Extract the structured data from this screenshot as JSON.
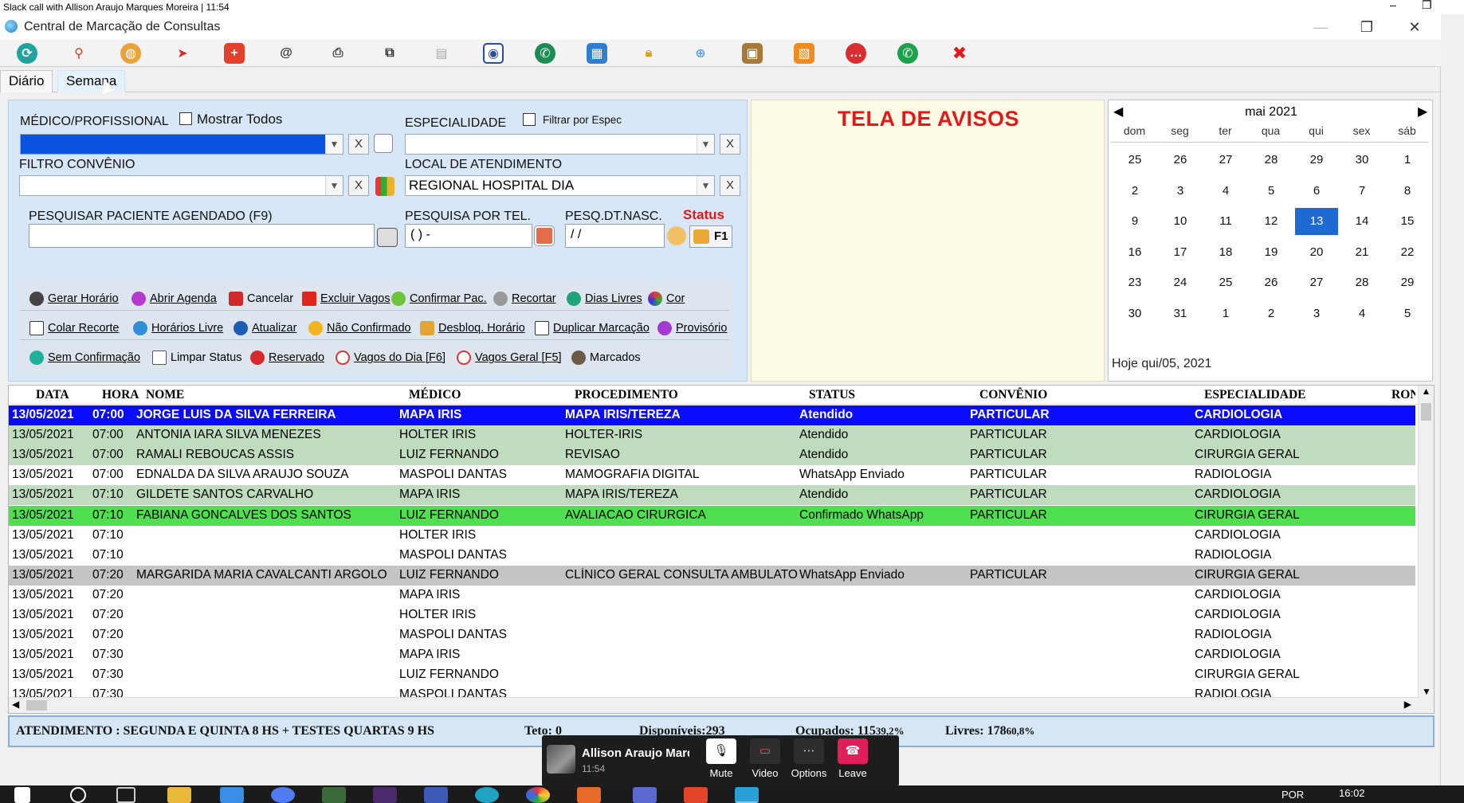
{
  "slack_bar": {
    "title": "Slack call with Allison Araujo Marques Moreira | 11:54"
  },
  "window": {
    "title": "Central de Marcação de Consultas"
  },
  "toolbar": {
    "icons": [
      "refresh-icon",
      "search-icon",
      "globe-icon",
      "fish-icon",
      "medical-kit-icon",
      "at-sign-icon",
      "print-icon",
      "copy-icon",
      "document-icon",
      "map-pin-icon",
      "whatsapp-green-icon",
      "calendar-icon",
      "lock-icon",
      "add-document-icon",
      "package-icon",
      "photo-icon",
      "chat-red-icon",
      "whatsapp-icon",
      "exit-icon"
    ]
  },
  "tabs": [
    {
      "label": "Diário"
    },
    {
      "label": "Semana"
    }
  ],
  "filters": {
    "medico_label": "MÉDICO/PROFISSIONAL",
    "mostrar_todos": "Mostrar Todos",
    "especialidade_label": "ESPECIALIDADE",
    "filtrar_espec": "Filtrar por Espec",
    "convenio_label": "FILTRO CONVÊNIO",
    "local_label": "LOCAL DE ATENDIMENTO",
    "local_value": "REGIONAL HOSPITAL DIA",
    "pesquisar_label": "PESQUISAR PACIENTE AGENDADO (F9)",
    "tel_label": "PESQUISA POR TEL.",
    "tel_value": "(  )     -",
    "nasc_label": "PESQ.DT.NASC.",
    "nasc_value": " /  /",
    "status_label": "Status",
    "f1_label": "F1",
    "x_label": "X"
  },
  "actions": {
    "gerar_horario": "Gerar Horário",
    "abrir_agenda": "Abrir Agenda",
    "cancelar": "Cancelar",
    "excluir_vagos": "Excluir Vagos",
    "confirmar_pac": "Confirmar Pac.",
    "recortar": "Recortar",
    "dias_livres": "Dias Livres",
    "cor": "Cor",
    "colar_recorte": "Colar Recorte",
    "horarios_livre": "Horários Livre",
    "atualizar": "Atualizar",
    "nao_confirmado": "Não Confirmado",
    "desbloq_horario": "Desbloq. Horário",
    "duplicar_marcacao": "Duplicar Marcação",
    "provisorio": "Provisório",
    "sem_confirmacao": "Sem Confirmação",
    "limpar_status": "Limpar Status",
    "reservado": "Reservado",
    "vagos_do_dia": "Vagos do Dia [F6]",
    "vagos_geral": "Vagos Geral [F5]",
    "marcados": "Marcados"
  },
  "notice": {
    "title": "TELA DE AVISOS"
  },
  "calendar": {
    "month": "mai 2021",
    "dow": [
      "dom",
      "seg",
      "ter",
      "qua",
      "qui",
      "sex",
      "sáb"
    ],
    "weeks": [
      [
        "25",
        "26",
        "27",
        "28",
        "29",
        "30",
        "1"
      ],
      [
        "2",
        "3",
        "4",
        "5",
        "6",
        "7",
        "8"
      ],
      [
        "9",
        "10",
        "11",
        "12",
        "13",
        "14",
        "15"
      ],
      [
        "16",
        "17",
        "18",
        "19",
        "20",
        "21",
        "22"
      ],
      [
        "23",
        "24",
        "25",
        "26",
        "27",
        "28",
        "29"
      ],
      [
        "30",
        "31",
        "1",
        "2",
        "3",
        "4",
        "5"
      ]
    ],
    "selected": "13",
    "today": "Hoje qui/05, 2021"
  },
  "grid": {
    "columns": [
      "DATA",
      "HORA",
      "NOME",
      "MÉDICO",
      "PROCEDIMENTO",
      "STATUS",
      "CONVÊNIO",
      "ESPECIALIDADE",
      "RON"
    ],
    "rows": [
      {
        "style": "sel",
        "data": "13/05/2021",
        "hora": "07:00",
        "nome": "JORGE LUIS DA SILVA FERREIRA",
        "medico": "MAPA IRIS",
        "proc": "MAPA IRIS/TEREZA",
        "status": "Atendido",
        "conv": "PARTICULAR",
        "esp": "CARDIOLOGIA"
      },
      {
        "style": "atend",
        "data": "13/05/2021",
        "hora": "07:00",
        "nome": "ANTONIA IARA SILVA MENEZES",
        "medico": "HOLTER IRIS",
        "proc": "HOLTER-IRIS",
        "status": "Atendido",
        "conv": "PARTICULAR",
        "esp": "CARDIOLOGIA"
      },
      {
        "style": "atend",
        "data": "13/05/2021",
        "hora": "07:00",
        "nome": "RAMALI REBOUCAS ASSIS",
        "medico": "LUIZ FERNANDO",
        "proc": "REVISAO",
        "status": "Atendido",
        "conv": "PARTICULAR",
        "esp": "CIRURGIA GERAL"
      },
      {
        "style": "",
        "data": "13/05/2021",
        "hora": "07:00",
        "nome": "EDNALDA DA SILVA ARAUJO SOUZA",
        "medico": "MASPOLI DANTAS",
        "proc": "MAMOGRAFIA DIGITAL",
        "status": "WhatsApp Enviado",
        "conv": "PARTICULAR",
        "esp": "RADIOLOGIA"
      },
      {
        "style": "atend",
        "data": "13/05/2021",
        "hora": "07:10",
        "nome": "GILDETE SANTOS CARVALHO",
        "medico": "MAPA IRIS",
        "proc": "MAPA IRIS/TEREZA",
        "status": "Atendido",
        "conv": "PARTICULAR",
        "esp": "CARDIOLOGIA"
      },
      {
        "style": "conf",
        "data": "13/05/2021",
        "hora": "07:10",
        "nome": "FABIANA GONCALVES DOS SANTOS",
        "medico": "LUIZ FERNANDO",
        "proc": "AVALIACAO CIRURGICA",
        "status": "Confirmado WhatsApp",
        "conv": "PARTICULAR",
        "esp": "CIRURGIA GERAL"
      },
      {
        "style": "",
        "data": "13/05/2021",
        "hora": "07:10",
        "nome": "",
        "medico": "HOLTER IRIS",
        "proc": "",
        "status": "",
        "conv": "",
        "esp": "CARDIOLOGIA"
      },
      {
        "style": "",
        "data": "13/05/2021",
        "hora": "07:10",
        "nome": "",
        "medico": "MASPOLI DANTAS",
        "proc": "",
        "status": "",
        "conv": "",
        "esp": "RADIOLOGIA"
      },
      {
        "style": "gray",
        "data": "13/05/2021",
        "hora": "07:20",
        "nome": "MARGARIDA MARIA CAVALCANTI ARGOLO",
        "medico": "LUIZ FERNANDO",
        "proc": "CLÍNICO GERAL CONSULTA AMBULATOR",
        "status": "WhatsApp Enviado",
        "conv": "PARTICULAR",
        "esp": "CIRURGIA GERAL"
      },
      {
        "style": "",
        "data": "13/05/2021",
        "hora": "07:20",
        "nome": "",
        "medico": "MAPA IRIS",
        "proc": "",
        "status": "",
        "conv": "",
        "esp": "CARDIOLOGIA"
      },
      {
        "style": "",
        "data": "13/05/2021",
        "hora": "07:20",
        "nome": "",
        "medico": "HOLTER IRIS",
        "proc": "",
        "status": "",
        "conv": "",
        "esp": "CARDIOLOGIA"
      },
      {
        "style": "",
        "data": "13/05/2021",
        "hora": "07:20",
        "nome": "",
        "medico": "MASPOLI DANTAS",
        "proc": "",
        "status": "",
        "conv": "",
        "esp": "RADIOLOGIA"
      },
      {
        "style": "",
        "data": "13/05/2021",
        "hora": "07:30",
        "nome": "",
        "medico": "MAPA IRIS",
        "proc": "",
        "status": "",
        "conv": "",
        "esp": "CARDIOLOGIA"
      },
      {
        "style": "",
        "data": "13/05/2021",
        "hora": "07:30",
        "nome": "",
        "medico": "LUIZ FERNANDO",
        "proc": "",
        "status": "",
        "conv": "",
        "esp": "CIRURGIA GERAL"
      },
      {
        "style": "",
        "data": "13/05/2021",
        "hora": "07:30",
        "nome": "",
        "medico": "MASPOLI DANTAS",
        "proc": "",
        "status": "",
        "conv": "",
        "esp": "RADIOLOGIA"
      }
    ]
  },
  "statusbar": {
    "atendimento": "ATENDIMENTO : SEGUNDA E QUINTA 8 HS + TESTES QUARTAS 9 HS",
    "teto": "Teto: 0",
    "disponiveis": "Disponíveis:293",
    "ocupados": "Ocupados: 115",
    "ocupados_pct": "39,2%",
    "livres": "Livres: 178",
    "livres_pct": "60,8%"
  },
  "slack_call": {
    "name": "Allison Araujo Marques Moreira",
    "time": "11:54",
    "mute": "Mute",
    "video": "Video",
    "options": "Options",
    "leave": "Leave"
  },
  "taskbar": {
    "lang": "POR",
    "clock": "16:02"
  }
}
